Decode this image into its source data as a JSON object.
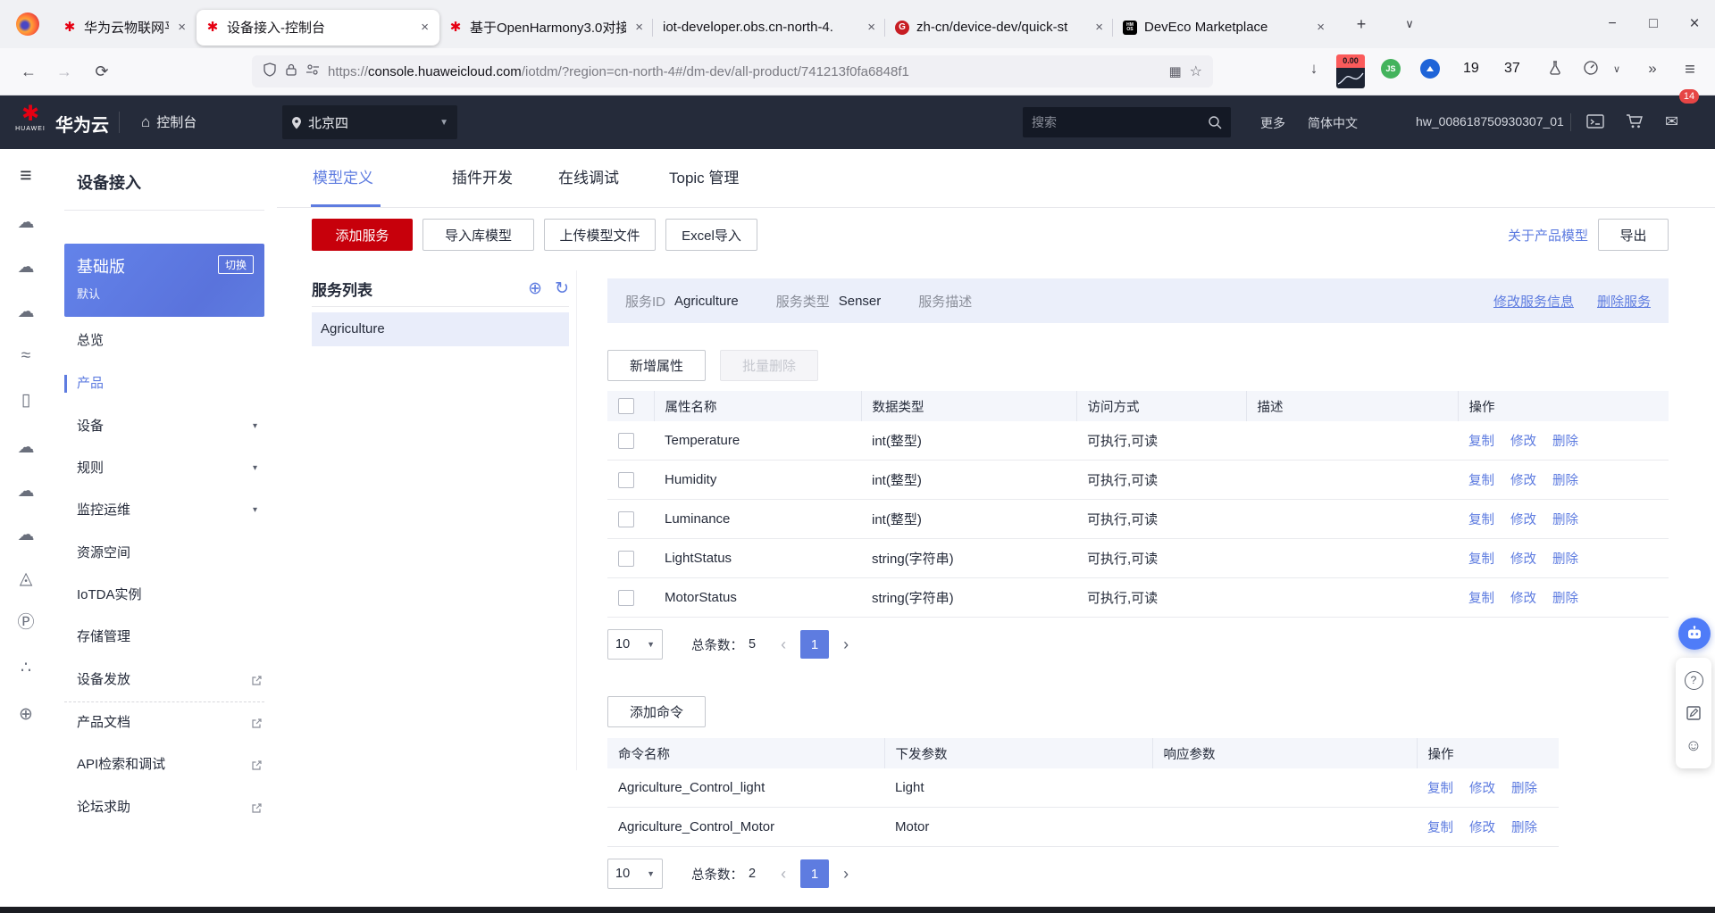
{
  "colors": {
    "primary": "#5e7ce0",
    "danger": "#c7000b",
    "header_bg": "#252b3a",
    "badge": "#e64545"
  },
  "icons": {
    "back": "←",
    "forward": "→",
    "reload": "⟳",
    "download": "↓",
    "overflow": "»",
    "menu": "≡",
    "tabs_down": "∨",
    "qr": "▦",
    "bookmark": "☆",
    "home": "⌂",
    "new_tab": "+",
    "plus_circle": "⊕",
    "refresh": "↻",
    "chevron_down": "▾",
    "select_caret": "▼",
    "page_prev": "‹",
    "page_next": "›",
    "mail": "✉",
    "smiley": "☺",
    "help": "?"
  },
  "rail_icons": [
    "☁",
    "☁",
    "☁",
    "≈",
    "▯",
    "☁",
    "☁",
    "☁",
    "◬",
    "Ⓟ",
    "∴",
    "⊕"
  ],
  "browser": {
    "window_controls": {
      "minimize": "−",
      "maximize": "□",
      "close": "×"
    },
    "tabs": [
      {
        "label": "华为云物联网平台_华为云Io",
        "close": "×"
      },
      {
        "label": "设备接入-控制台",
        "close": "×"
      },
      {
        "label": "基于OpenHarmony3.0对接",
        "close": "×"
      },
      {
        "label": "iot-developer.obs.cn-north-4.",
        "close": "×"
      },
      {
        "label": "zh-cn/device-dev/quick-st",
        "close": "×"
      },
      {
        "label": "DevEco Marketplace",
        "close": "×"
      }
    ],
    "gitee_letter": "G",
    "hmos_text": "HM OS",
    "url": {
      "scheme": "https://",
      "domain": "console.huaweicloud.com",
      "path": "/iotdm/?region=cn-north-4#/dm-dev/all-product/741213f0fa6848f1"
    },
    "toolbar": {
      "stock_badge": "0.00",
      "js_badge": "JS",
      "count_a": "19",
      "count_b": "37"
    }
  },
  "console_header": {
    "logo_text": "HUAWEI",
    "brand": "华为云",
    "console": "控制台",
    "region": "北京四",
    "search_placeholder": "搜索",
    "more": "更多",
    "language": "简体中文",
    "username": "hw_008618750930307_01",
    "mail_badge": "14"
  },
  "sidebar": {
    "title": "设备接入",
    "edition": {
      "name": "基础版",
      "switch_label": "切换",
      "subtitle": "默认"
    },
    "items": [
      {
        "label": "总览"
      },
      {
        "label": "产品"
      },
      {
        "label": "设备"
      },
      {
        "label": "规则"
      },
      {
        "label": "监控运维"
      },
      {
        "label": "资源空间"
      },
      {
        "label": "IoTDA实例"
      },
      {
        "label": "存储管理"
      },
      {
        "label": "设备发放"
      },
      {
        "label": "产品文档"
      },
      {
        "label": "API检索和调试"
      },
      {
        "label": "论坛求助"
      }
    ]
  },
  "main": {
    "tabs": [
      {
        "label": "模型定义"
      },
      {
        "label": "插件开发"
      },
      {
        "label": "在线调试"
      },
      {
        "label": "Topic 管理"
      }
    ],
    "toolbar": {
      "add_service": "添加服务",
      "import_model": "导入库模型",
      "upload_model": "上传模型文件",
      "excel_import": "Excel导入",
      "about_link": "关于产品模型",
      "export": "导出"
    },
    "service_list": {
      "title": "服务列表",
      "items": [
        {
          "name": "Agriculture"
        }
      ]
    },
    "service_info": {
      "id_label": "服务ID",
      "id_value": "Agriculture",
      "type_label": "服务类型",
      "type_value": "Senser",
      "desc_label": "服务描述",
      "edit_link": "修改服务信息",
      "delete_link": "删除服务"
    },
    "properties": {
      "add_button": "新增属性",
      "batch_delete_button": "批量删除",
      "columns": [
        "属性名称",
        "数据类型",
        "访问方式",
        "描述",
        "操作"
      ],
      "rows": [
        {
          "name": "Temperature",
          "data_type": "int(整型)",
          "access": "可执行,可读",
          "desc": ""
        },
        {
          "name": "Humidity",
          "data_type": "int(整型)",
          "access": "可执行,可读",
          "desc": ""
        },
        {
          "name": "Luminance",
          "data_type": "int(整型)",
          "access": "可执行,可读",
          "desc": ""
        },
        {
          "name": "LightStatus",
          "data_type": "string(字符串)",
          "access": "可执行,可读",
          "desc": ""
        },
        {
          "name": "MotorStatus",
          "data_type": "string(字符串)",
          "access": "可执行,可读",
          "desc": ""
        }
      ],
      "row_actions": [
        "复制",
        "修改",
        "删除"
      ],
      "pagination": {
        "page_size": "10",
        "total_label": "总条数：",
        "total": "5",
        "current_page": "1"
      }
    },
    "commands": {
      "add_button": "添加命令",
      "columns": [
        "命令名称",
        "下发参数",
        "响应参数",
        "操作"
      ],
      "rows": [
        {
          "name": "Agriculture_Control_light",
          "down_param": "Light",
          "resp_param": ""
        },
        {
          "name": "Agriculture_Control_Motor",
          "down_param": "Motor",
          "resp_param": ""
        }
      ],
      "row_actions": [
        "复制",
        "修改",
        "删除"
      ],
      "pagination": {
        "page_size": "10",
        "total_label": "总条数：",
        "total": "2",
        "current_page": "1"
      }
    }
  }
}
